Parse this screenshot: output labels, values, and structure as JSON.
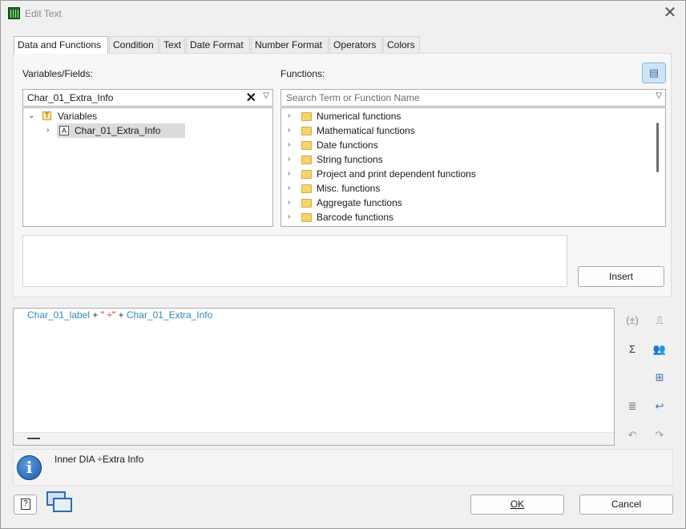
{
  "window": {
    "title": "Edit Text"
  },
  "tabs": [
    "Data and Functions",
    "Condition",
    "Text",
    "Date Format",
    "Number Format",
    "Operators",
    "Colors"
  ],
  "variables": {
    "label": "Variables/Fields:",
    "combo_value": "Char_01_Extra_Info",
    "tree_root": "Variables",
    "tree_child": "Char_01_Extra_Info"
  },
  "functions": {
    "label": "Functions:",
    "search_placeholder": "Search Term or Function Name",
    "items": [
      "Numerical functions",
      "Mathematical functions",
      "Date functions",
      "String functions",
      "Project and print dependent functions",
      "Misc. functions",
      "Aggregate functions",
      "Barcode functions"
    ]
  },
  "insert_button": "Insert",
  "editor": {
    "tok1": "Char_01_label",
    "tok2": " + ",
    "tok3": "\" ÷\"",
    "tok4": " + ",
    "tok5": "Char_01_Extra_Info"
  },
  "info": {
    "text": "Inner DIA ÷Extra Info"
  },
  "buttons": {
    "ok": "OK",
    "cancel": "Cancel"
  },
  "colors": {
    "identifier": "#2f8ab8",
    "string": "#c22222",
    "folder": "#f7d36b",
    "info_icon": "#1a5aa8"
  }
}
